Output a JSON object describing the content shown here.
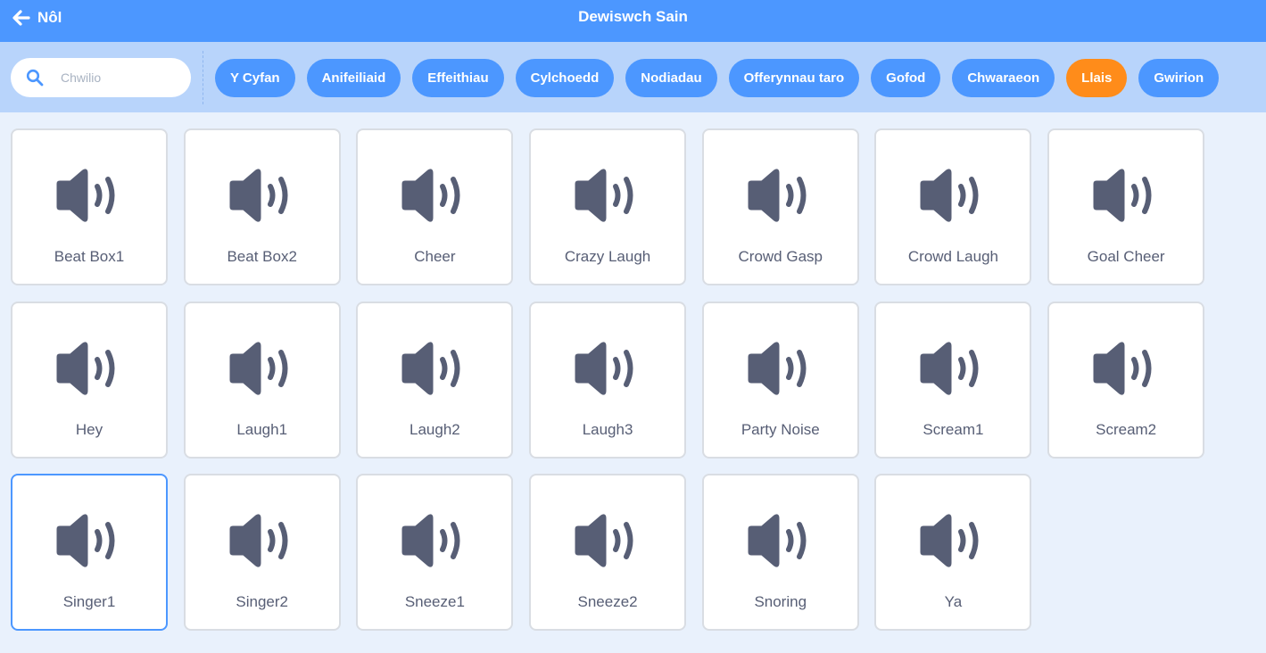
{
  "header": {
    "back_label": "Nôl",
    "title": "Dewiswch Sain"
  },
  "search": {
    "placeholder": "Chwilio",
    "value": ""
  },
  "tags": [
    {
      "label": "Y Cyfan",
      "active": false
    },
    {
      "label": "Anifeiliaid",
      "active": false
    },
    {
      "label": "Effeithiau",
      "active": false
    },
    {
      "label": "Cylchoedd",
      "active": false
    },
    {
      "label": "Nodiadau",
      "active": false
    },
    {
      "label": "Offerynnau taro",
      "active": false
    },
    {
      "label": "Gofod",
      "active": false
    },
    {
      "label": "Chwaraeon",
      "active": false
    },
    {
      "label": "Llais",
      "active": true
    },
    {
      "label": "Gwirion",
      "active": false
    }
  ],
  "sounds": [
    {
      "name": "Beat Box1"
    },
    {
      "name": "Beat Box2"
    },
    {
      "name": "Cheer"
    },
    {
      "name": "Crazy Laugh"
    },
    {
      "name": "Crowd Gasp"
    },
    {
      "name": "Crowd Laugh"
    },
    {
      "name": "Goal Cheer"
    },
    {
      "name": "Hey"
    },
    {
      "name": "Laugh1"
    },
    {
      "name": "Laugh2"
    },
    {
      "name": "Laugh3"
    },
    {
      "name": "Party Noise"
    },
    {
      "name": "Scream1"
    },
    {
      "name": "Scream2"
    },
    {
      "name": "Singer1",
      "selected": true
    },
    {
      "name": "Singer2"
    },
    {
      "name": "Sneeze1"
    },
    {
      "name": "Sneeze2"
    },
    {
      "name": "Snoring"
    },
    {
      "name": "Ya"
    }
  ],
  "colors": {
    "header": "#4c97ff",
    "filterbar": "#b8d4fb",
    "active_tag": "#ff8c1a",
    "icon": "#575e75",
    "background": "#e9f1fc"
  },
  "icons": {
    "back": "arrow-left-icon",
    "search": "search-icon",
    "sound": "speaker-icon"
  }
}
